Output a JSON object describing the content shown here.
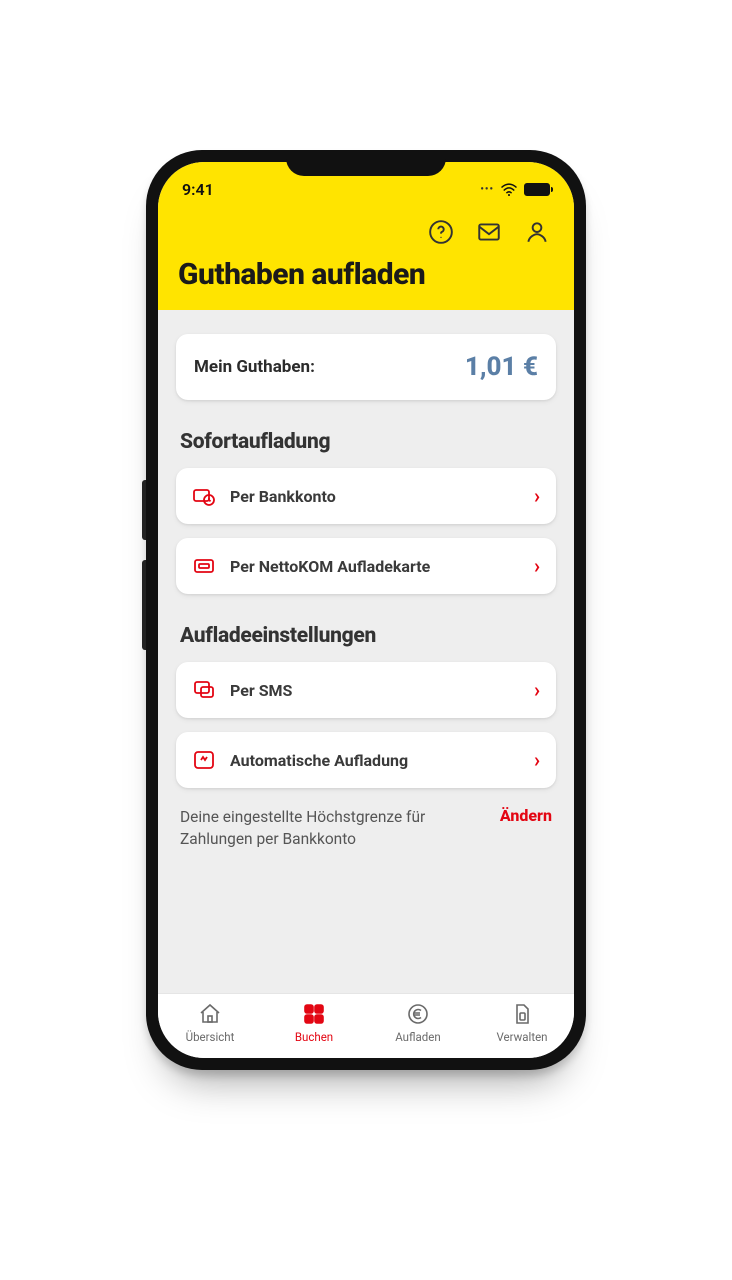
{
  "status": {
    "time": "9:41"
  },
  "header": {
    "title": "Guthaben aufladen"
  },
  "balance": {
    "label": "Mein Guthaben:",
    "value": "1,01 €"
  },
  "sections": {
    "instant": {
      "title": "Sofortaufladung",
      "items": [
        {
          "label": "Per Bankkonto"
        },
        {
          "label": "Per NettoKOM Aufladekarte"
        }
      ]
    },
    "settings": {
      "title": "Aufladeeinstellungen",
      "items": [
        {
          "label": "Per SMS"
        },
        {
          "label": "Automatische Aufladung"
        }
      ]
    }
  },
  "limit": {
    "text": "Deine eingestellte Höchstgrenze für Zahlungen per Bankkonto",
    "action": "Ändern"
  },
  "nav": {
    "items": [
      {
        "label": "Übersicht"
      },
      {
        "label": "Buchen"
      },
      {
        "label": "Aufladen"
      },
      {
        "label": "Verwalten"
      }
    ],
    "active_index": 1
  },
  "colors": {
    "brand_yellow": "#ffe400",
    "accent_red": "#e30613",
    "balance_blue": "#5b7fa6"
  }
}
